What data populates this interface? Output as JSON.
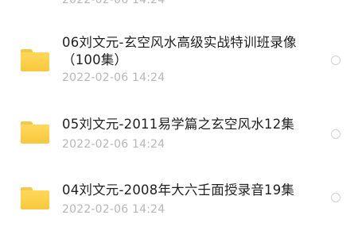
{
  "previous_item": {
    "date_partial": "2022-02-06 14:24"
  },
  "files": [
    {
      "name": "06刘文元-玄空风水高级实战特训班录像（100集）",
      "date": "2022-02-06 14:24",
      "icon": "folder-icon"
    },
    {
      "name": "05刘文元-2011易学篇之玄空风水12集",
      "date": "2022-02-06 14:24",
      "icon": "folder-icon"
    },
    {
      "name": "04刘文元-2008年大六壬面授录音19集",
      "date": "2022-02-06 14:24",
      "icon": "folder-icon"
    }
  ],
  "colors": {
    "folder": "#F8C83D",
    "date_text": "#B7B7B7",
    "name_text": "#1F1F1F",
    "radio_border": "#D0D0D0"
  }
}
